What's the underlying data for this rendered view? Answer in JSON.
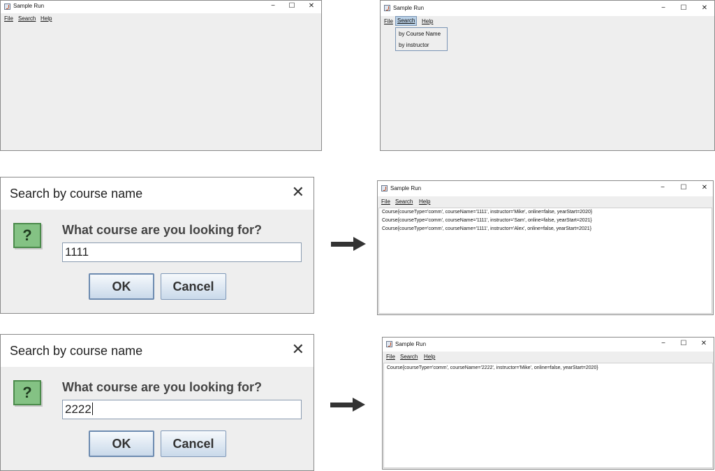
{
  "windows": {
    "w1": {
      "title": "Sample Run",
      "menu": [
        "File",
        "Search",
        "Help"
      ]
    },
    "w2": {
      "title": "Sample Run",
      "menu": [
        "File",
        "Search",
        "Help"
      ],
      "popup": [
        "by Course Name",
        "by instructor"
      ]
    },
    "w3": {
      "title": "Sample Run",
      "menu": [
        "File",
        "Search",
        "Help"
      ],
      "lines": [
        "Course{courseType='comm', courseName='1111', instructor='Mike', online=false, yearStart=2020}",
        "Course{courseType='comm', courseName='1111', instructor='Sam', online=false, yearStart=2021}",
        "Course{courseType='comm', courseName='1111', instructor='Alex', online=false, yearStart=2021}"
      ]
    },
    "w4": {
      "title": "Sample Run",
      "menu": [
        "File",
        "Search",
        "Help"
      ],
      "lines": [
        "Course{courseType='comm', courseName='2222', instructor='Mike', online=false, yearStart=2020}"
      ]
    }
  },
  "window_controls": {
    "minimize": "−",
    "maximize": "☐",
    "close": "✕"
  },
  "dialogs": {
    "d1": {
      "title": "Search by course name",
      "close": "✕",
      "icon": "?",
      "prompt": "What course are you looking for?",
      "value": "1111",
      "ok": "OK",
      "cancel": "Cancel"
    },
    "d2": {
      "title": "Search by course name",
      "close": "✕",
      "icon": "?",
      "prompt": "What course are you looking for?",
      "value": "2222",
      "ok": "OK",
      "cancel": "Cancel"
    }
  },
  "icons": {
    "app": "java-app-icon",
    "question": "question-icon",
    "arrow": "right-arrow-icon"
  },
  "colors": {
    "window_bg": "#eeeeee",
    "menu_highlight": "#b8cfe5",
    "question_icon": "#84c284",
    "arrow": "#333333"
  }
}
